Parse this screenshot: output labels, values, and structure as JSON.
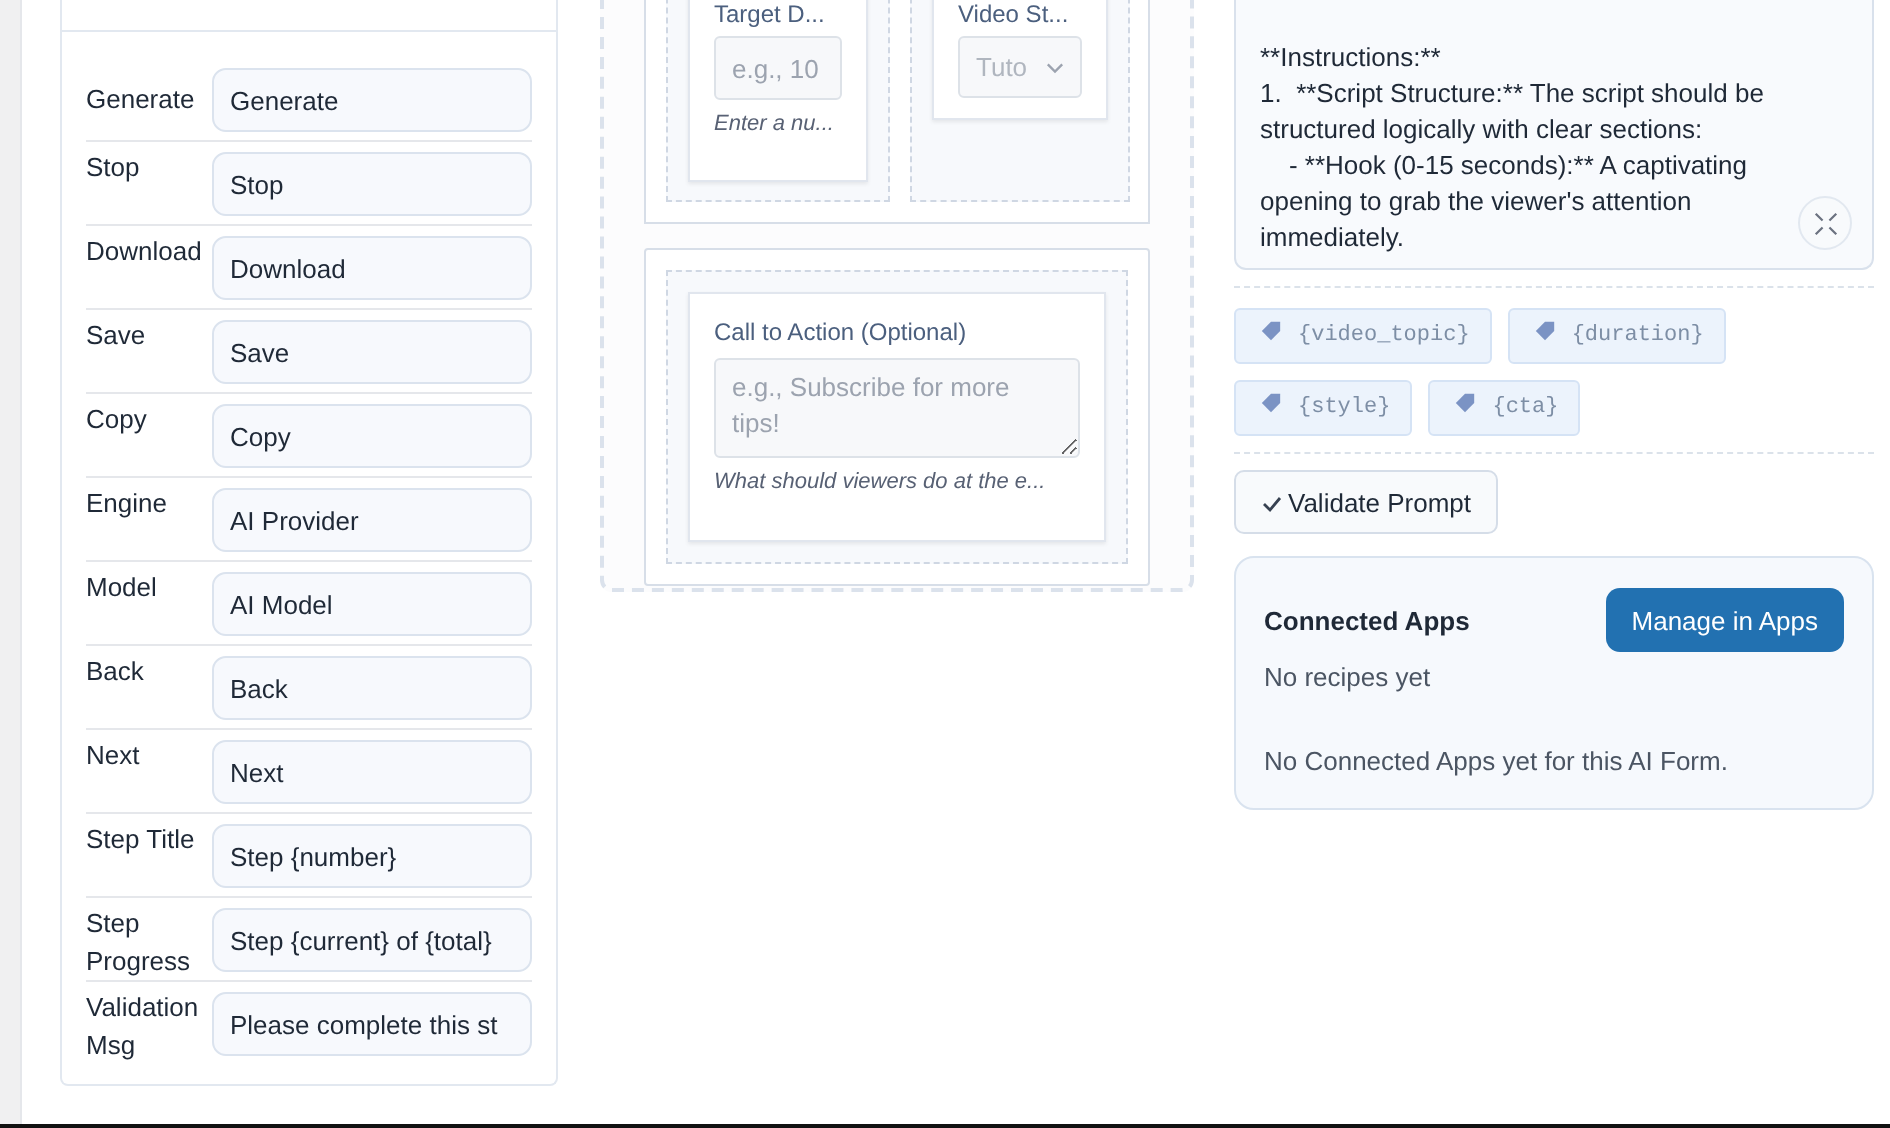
{
  "labels_panel": {
    "rows": [
      {
        "label": "Generate",
        "value": "Generate"
      },
      {
        "label": "Stop",
        "value": "Stop"
      },
      {
        "label": "Download",
        "value": "Download"
      },
      {
        "label": "Save",
        "value": "Save"
      },
      {
        "label": "Copy",
        "value": "Copy"
      },
      {
        "label": "Engine",
        "value": "AI Provider"
      },
      {
        "label": "Model",
        "value": "AI Model"
      },
      {
        "label": "Back",
        "value": "Back"
      },
      {
        "label": "Next",
        "value": "Next"
      },
      {
        "label": "Step Title",
        "value": "Step {number}"
      },
      {
        "label": "Step Progress",
        "value": "Step {current} of {total}"
      },
      {
        "label": "Validation Msg",
        "value": "Please complete this st"
      }
    ]
  },
  "form_canvas": {
    "columns": [
      {
        "label": "Target D...",
        "kind": "number",
        "placeholder": "e.g., 10",
        "help": "Enter a nu..."
      },
      {
        "label": "Video St...",
        "kind": "select",
        "placeholder": "Tuto"
      }
    ],
    "cta_field": {
      "label": "Call to Action (Optional)",
      "placeholder": "e.g., Subscribe for more tips!",
      "help": "What should viewers do at the e..."
    }
  },
  "prompt": {
    "lines": [
      "**Instructions:**",
      "1.  **Script Structure:** The script should be structured logically with clear sections:",
      "    - **Hook (0-15 seconds):** A captivating opening to grab the viewer's attention immediately."
    ],
    "variables": [
      {
        "label": "{video_topic}"
      },
      {
        "label": "{duration}"
      },
      {
        "label": "{style}"
      },
      {
        "label": "{cta}"
      }
    ],
    "validate_button": "Validate Prompt"
  },
  "connected_apps": {
    "title": "Connected Apps",
    "manage_button": "Manage in Apps",
    "recipes_text": "No recipes yet",
    "empty_text": "No Connected Apps yet for this AI Form."
  }
}
